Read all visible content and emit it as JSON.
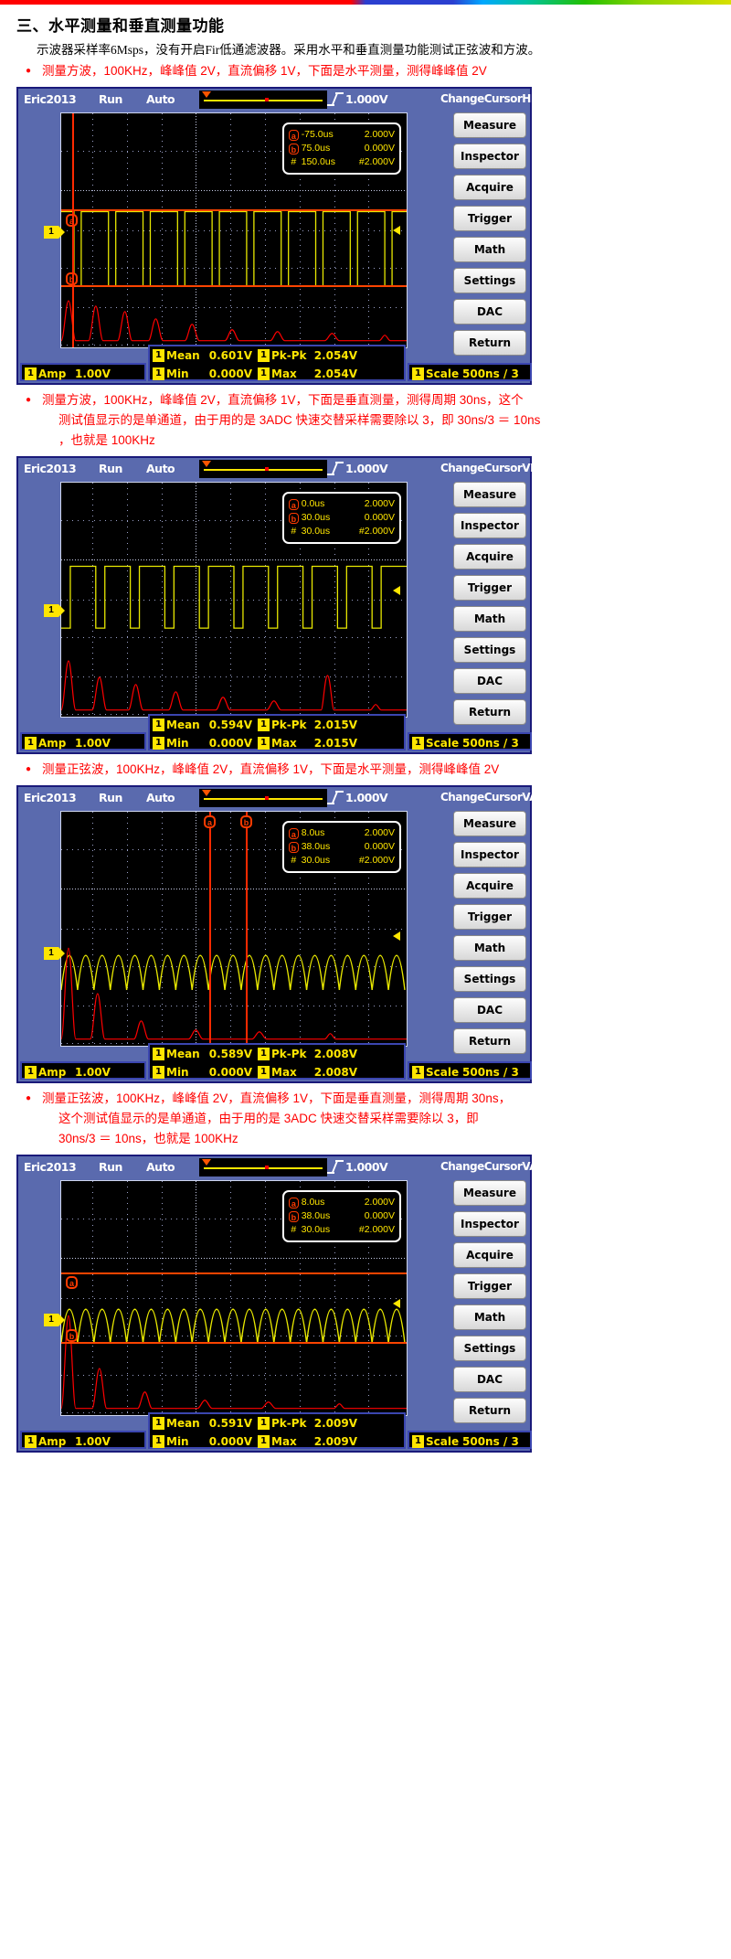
{
  "document": {
    "section_heading": "三、水平测量和垂直测量功能",
    "intro": "示波器采样率6Msps，没有开启Fir低通滤波器。采用水平和垂直测量功能测试正弦波和方波。"
  },
  "notes": [
    {
      "id": "note-1",
      "lines": [
        "测量方波，100KHz，峰峰值 2V，直流偏移 1V，下面是水平测量，测得峰峰值 2V"
      ]
    },
    {
      "id": "note-2",
      "lines": [
        "测量方波，100KHz，峰峰值 2V，直流偏移 1V，下面是垂直测量，测得周期 30ns，这个",
        "测试值显示的是单通道，由于用的是 3ADC 快速交替采样需要除以 3，即 30ns/3 ＝ 10ns",
        "，也就是 100KHz"
      ]
    },
    {
      "id": "note-3",
      "lines": [
        "测量正弦波，100KHz，峰峰值 2V，直流偏移 1V，下面是水平测量，测得峰峰值 2V"
      ]
    },
    {
      "id": "note-4",
      "lines": [
        "测量正弦波，100KHz，峰峰值 2V，直流偏移 1V，下面是垂直测量，测得周期 30ns，",
        "这个测试值显示的是单通道，由于用的是 3ADC 快速交替采样需要除以 3，即",
        "30ns/3 ＝ 10ns，也就是 100KHz"
      ]
    }
  ],
  "colors": {
    "chassis": "#5a6aae",
    "screen": "#000000",
    "trace_ch1": "#e8e800",
    "trace_fft": "#ff0000",
    "cursor": "#ff2a00",
    "readout": "#ffe600",
    "red_text": "#ff0000"
  },
  "softkeys": [
    "Measure",
    "Inspector",
    "Acquire",
    "Trigger",
    "Math",
    "Settings",
    "DAC",
    "Return"
  ],
  "scopes": [
    {
      "id": "scope-1",
      "header": {
        "brand": "Eric2013",
        "run": "Run",
        "mode": "Auto",
        "volts": "1.000V",
        "cursor_mode": "ChangeCursorHB"
      },
      "cursor_box": {
        "a_label": "a",
        "a_time": "-75.0us",
        "a_volt": "2.000V",
        "b_label": "b",
        "b_time": "75.0us",
        "b_volt": "0.000V",
        "d_label": "#",
        "d_time": "150.0us",
        "d_volt": "#2.000V"
      },
      "cursor_type": "horizontal",
      "channel_marker": "1",
      "measurements": {
        "amp_label": "Amp",
        "amp_value": "1.00V",
        "mean_label": "Mean",
        "mean_value": "0.601V",
        "pkpk_label": "Pk-Pk",
        "pkpk_value": "2.054V",
        "min_label": "Min",
        "min_value": "0.000V",
        "max_label": "Max",
        "max_value": "2.054V",
        "scale_label": "Scale",
        "scale_value": "500ns / 3"
      },
      "waveform": "square"
    },
    {
      "id": "scope-2",
      "header": {
        "brand": "Eric2013",
        "run": "Run",
        "mode": "Auto",
        "volts": "1.000V",
        "cursor_mode": "ChangeCursorVB"
      },
      "cursor_box": {
        "a_label": "a",
        "a_time": "0.0us",
        "a_volt": "2.000V",
        "b_label": "b",
        "b_time": "30.0us",
        "b_volt": "0.000V",
        "d_label": "#",
        "d_time": "30.0us",
        "d_volt": "#2.000V"
      },
      "cursor_type": "vertical-offscreen",
      "channel_marker": "1",
      "measurements": {
        "amp_label": "Amp",
        "amp_value": "1.00V",
        "mean_label": "Mean",
        "mean_value": "0.594V",
        "pkpk_label": "Pk-Pk",
        "pkpk_value": "2.015V",
        "min_label": "Min",
        "min_value": "0.000V",
        "max_label": "Max",
        "max_value": "2.015V",
        "scale_label": "Scale",
        "scale_value": "500ns / 3"
      },
      "waveform": "square"
    },
    {
      "id": "scope-3",
      "header": {
        "brand": "Eric2013",
        "run": "Run",
        "mode": "Auto",
        "volts": "1.000V",
        "cursor_mode": "ChangeCursorVA"
      },
      "cursor_box": {
        "a_label": "a",
        "a_time": "8.0us",
        "a_volt": "2.000V",
        "b_label": "b",
        "b_time": "38.0us",
        "b_volt": "0.000V",
        "d_label": "#",
        "d_time": "30.0us",
        "d_volt": "#2.000V"
      },
      "cursor_type": "vertical",
      "channel_marker": "1",
      "measurements": {
        "amp_label": "Amp",
        "amp_value": "1.00V",
        "mean_label": "Mean",
        "mean_value": "0.589V",
        "pkpk_label": "Pk-Pk",
        "pkpk_value": "2.008V",
        "min_label": "Min",
        "min_value": "0.000V",
        "max_label": "Max",
        "max_value": "2.008V",
        "scale_label": "Scale",
        "scale_value": "500ns / 3"
      },
      "waveform": "sine"
    },
    {
      "id": "scope-4",
      "header": {
        "brand": "Eric2013",
        "run": "Run",
        "mode": "Auto",
        "volts": "1.000V",
        "cursor_mode": "ChangeCursorVA"
      },
      "cursor_box": {
        "a_label": "a",
        "a_time": "8.0us",
        "a_volt": "2.000V",
        "b_label": "b",
        "b_time": "38.0us",
        "b_volt": "0.000V",
        "d_label": "#",
        "d_time": "30.0us",
        "d_volt": "#2.000V"
      },
      "cursor_type": "horizontal",
      "channel_marker": "1",
      "measurements": {
        "amp_label": "Amp",
        "amp_value": "1.00V",
        "mean_label": "Mean",
        "mean_value": "0.591V",
        "pkpk_label": "Pk-Pk",
        "pkpk_value": "2.009V",
        "min_label": "Min",
        "min_value": "0.000V",
        "max_label": "Max",
        "max_value": "2.009V",
        "scale_label": "Scale",
        "scale_value": "500ns / 3"
      },
      "waveform": "sine"
    }
  ]
}
